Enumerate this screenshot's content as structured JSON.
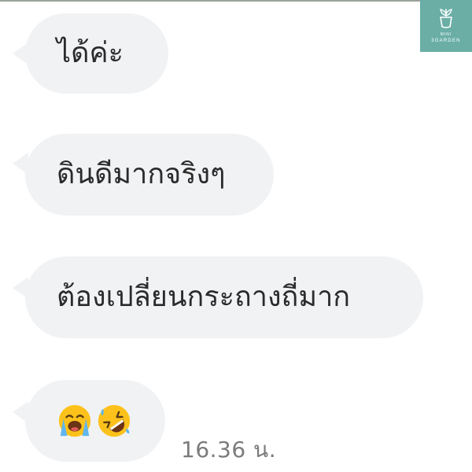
{
  "logo": {
    "line1": "MINI",
    "line2": "3GARDEN",
    "icon": "plant-pot-icon",
    "color": "#6aaea6"
  },
  "messages": [
    {
      "text": "ได้ค่ะ"
    },
    {
      "text": "ดินดีมากจริงๆ"
    },
    {
      "text": "ต้องเปลี่ยนกระถางถี่มาก"
    },
    {
      "emojis": [
        "loudly-crying-face-emoji",
        "rolling-on-floor-laughing-emoji"
      ]
    }
  ],
  "timestamp": "16.36 น.",
  "colors": {
    "bubble": "#f1f2f4",
    "text": "#2b2b2b",
    "timestamp": "#7b7b7b"
  }
}
